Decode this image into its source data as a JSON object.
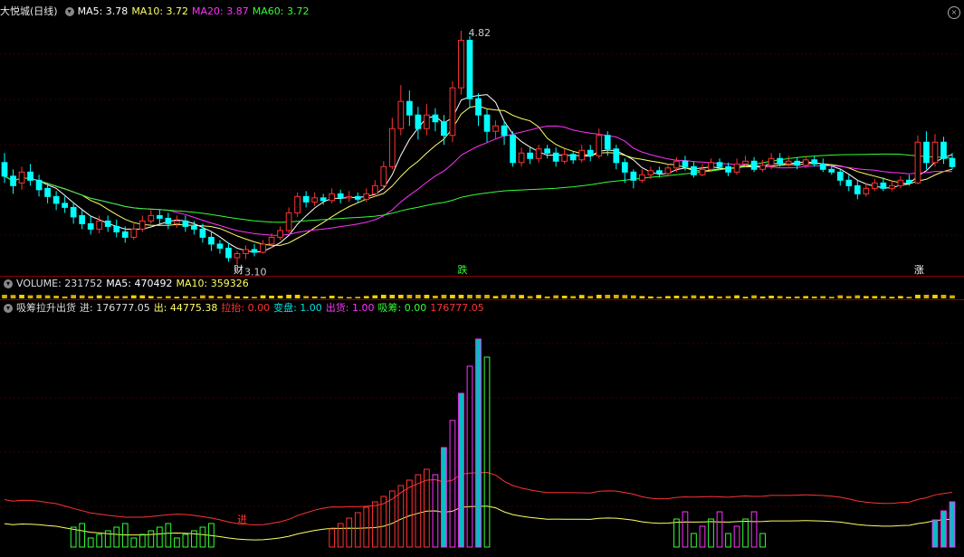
{
  "main": {
    "title": "大悦城(日线)",
    "ma5": "MA5: 3.78",
    "ma10": "MA10: 3.72",
    "ma20": "MA20: 3.87",
    "ma60": "MA60: 3.72",
    "high_label": "4.82",
    "low_label": "3.10",
    "marker_cai": "财",
    "marker_die": "跌",
    "marker_zhang": "涨"
  },
  "volume": {
    "label": "VOLUME: 231752",
    "ma5": "MA5: 470492",
    "ma10": "MA10: 359326"
  },
  "indicator": {
    "title": "吸筹拉升出货",
    "jin": "进: 176777.05",
    "chu": "出: 44775.38",
    "lata": "拉抬: 0.00",
    "biandian": "变盘: 1.00",
    "chuhuo": "出货: 1.00",
    "xichou": "吸筹: 0.00",
    "extra": "176777.05",
    "mark_jin": "进"
  },
  "colors": {
    "up": "#ff3333",
    "down": "#00ffff",
    "ma5": "#ffffff",
    "ma10": "#ffff66",
    "ma20": "#ff33ff",
    "ma60": "#33ff33"
  },
  "chart_data": {
    "type": "candlestick",
    "price_range": [
      3.05,
      4.9
    ],
    "high": 4.82,
    "low": 3.1,
    "candles": [
      [
        3.85,
        3.75,
        3.92,
        3.7
      ],
      [
        3.75,
        3.68,
        3.8,
        3.62
      ],
      [
        3.7,
        3.78,
        3.82,
        3.65
      ],
      [
        3.78,
        3.72,
        3.84,
        3.68
      ],
      [
        3.72,
        3.65,
        3.76,
        3.6
      ],
      [
        3.66,
        3.6,
        3.7,
        3.55
      ],
      [
        3.6,
        3.55,
        3.64,
        3.5
      ],
      [
        3.55,
        3.52,
        3.6,
        3.48
      ],
      [
        3.52,
        3.45,
        3.56,
        3.4
      ],
      [
        3.46,
        3.4,
        3.5,
        3.36
      ],
      [
        3.4,
        3.36,
        3.46,
        3.32
      ],
      [
        3.36,
        3.42,
        3.46,
        3.33
      ],
      [
        3.42,
        3.38,
        3.46,
        3.34
      ],
      [
        3.38,
        3.34,
        3.43,
        3.3
      ],
      [
        3.34,
        3.3,
        3.38,
        3.26
      ],
      [
        3.3,
        3.36,
        3.4,
        3.28
      ],
      [
        3.36,
        3.42,
        3.46,
        3.34
      ],
      [
        3.42,
        3.46,
        3.5,
        3.4
      ],
      [
        3.46,
        3.44,
        3.5,
        3.4
      ],
      [
        3.44,
        3.4,
        3.48,
        3.36
      ],
      [
        3.4,
        3.42,
        3.46,
        3.37
      ],
      [
        3.42,
        3.38,
        3.46,
        3.34
      ],
      [
        3.38,
        3.36,
        3.42,
        3.32
      ],
      [
        3.36,
        3.3,
        3.4,
        3.26
      ],
      [
        3.3,
        3.25,
        3.34,
        3.2
      ],
      [
        3.25,
        3.22,
        3.28,
        3.18
      ],
      [
        3.22,
        3.15,
        3.26,
        3.12
      ],
      [
        3.15,
        3.18,
        3.2,
        3.1
      ],
      [
        3.18,
        3.21,
        3.24,
        3.14
      ],
      [
        3.21,
        3.19,
        3.25,
        3.16
      ],
      [
        3.19,
        3.25,
        3.28,
        3.18
      ],
      [
        3.25,
        3.3,
        3.33,
        3.22
      ],
      [
        3.3,
        3.35,
        3.38,
        3.28
      ],
      [
        3.35,
        3.48,
        3.52,
        3.33
      ],
      [
        3.48,
        3.6,
        3.63,
        3.45
      ],
      [
        3.6,
        3.56,
        3.64,
        3.52
      ],
      [
        3.56,
        3.59,
        3.63,
        3.53
      ],
      [
        3.59,
        3.57,
        3.62,
        3.54
      ],
      [
        3.57,
        3.62,
        3.66,
        3.55
      ],
      [
        3.62,
        3.59,
        3.65,
        3.55
      ],
      [
        3.59,
        3.6,
        3.64,
        3.56
      ],
      [
        3.6,
        3.58,
        3.63,
        3.55
      ],
      [
        3.58,
        3.62,
        3.66,
        3.56
      ],
      [
        3.62,
        3.68,
        3.72,
        3.6
      ],
      [
        3.68,
        3.82,
        3.86,
        3.65
      ],
      [
        3.82,
        4.1,
        4.18,
        3.8
      ],
      [
        4.1,
        4.3,
        4.42,
        4.05
      ],
      [
        4.3,
        4.2,
        4.38,
        4.12
      ],
      [
        4.2,
        4.1,
        4.26,
        4.02
      ],
      [
        4.1,
        4.2,
        4.28,
        4.05
      ],
      [
        4.2,
        4.15,
        4.25,
        4.08
      ],
      [
        4.15,
        4.05,
        4.2,
        3.98
      ],
      [
        4.05,
        4.4,
        4.45,
        4.0
      ],
      [
        4.4,
        4.75,
        4.82,
        4.35
      ],
      [
        4.75,
        4.32,
        4.78,
        4.25
      ],
      [
        4.32,
        4.2,
        4.36,
        4.12
      ],
      [
        4.2,
        4.08,
        4.24,
        4.0
      ],
      [
        4.08,
        4.12,
        4.16,
        4.02
      ],
      [
        4.12,
        4.05,
        4.16,
        3.98
      ],
      [
        4.05,
        3.85,
        4.08,
        3.82
      ],
      [
        3.85,
        3.92,
        3.96,
        3.82
      ],
      [
        3.92,
        3.88,
        3.96,
        3.84
      ],
      [
        3.88,
        3.95,
        3.98,
        3.85
      ],
      [
        3.95,
        3.92,
        3.98,
        3.88
      ],
      [
        3.92,
        3.86,
        3.96,
        3.82
      ],
      [
        3.86,
        3.91,
        3.95,
        3.84
      ],
      [
        3.91,
        3.87,
        3.93,
        3.84
      ],
      [
        3.87,
        3.94,
        3.98,
        3.85
      ],
      [
        3.94,
        3.9,
        3.98,
        3.86
      ],
      [
        3.9,
        4.05,
        4.1,
        3.88
      ],
      [
        4.05,
        3.95,
        4.08,
        3.9
      ],
      [
        3.95,
        3.85,
        3.98,
        3.8
      ],
      [
        3.85,
        3.78,
        3.88,
        3.7
      ],
      [
        3.78,
        3.72,
        3.8,
        3.66
      ],
      [
        3.72,
        3.76,
        3.8,
        3.7
      ],
      [
        3.76,
        3.79,
        3.82,
        3.73
      ],
      [
        3.79,
        3.77,
        3.82,
        3.74
      ],
      [
        3.77,
        3.81,
        3.84,
        3.75
      ],
      [
        3.81,
        3.86,
        3.89,
        3.78
      ],
      [
        3.86,
        3.82,
        3.9,
        3.79
      ],
      [
        3.82,
        3.76,
        3.86,
        3.74
      ],
      [
        3.76,
        3.8,
        3.84,
        3.75
      ],
      [
        3.8,
        3.85,
        3.88,
        3.78
      ],
      [
        3.85,
        3.82,
        3.88,
        3.8
      ],
      [
        3.82,
        3.78,
        3.85,
        3.75
      ],
      [
        3.78,
        3.84,
        3.88,
        3.76
      ],
      [
        3.84,
        3.86,
        3.9,
        3.82
      ],
      [
        3.86,
        3.8,
        3.89,
        3.78
      ],
      [
        3.8,
        3.83,
        3.87,
        3.78
      ],
      [
        3.83,
        3.88,
        3.92,
        3.8
      ],
      [
        3.88,
        3.84,
        3.92,
        3.82
      ],
      [
        3.84,
        3.86,
        3.9,
        3.82
      ],
      [
        3.86,
        3.83,
        3.89,
        3.8
      ],
      [
        3.83,
        3.87,
        3.9,
        3.81
      ],
      [
        3.87,
        3.84,
        3.9,
        3.82
      ],
      [
        3.84,
        3.8,
        3.88,
        3.78
      ],
      [
        3.8,
        3.78,
        3.84,
        3.76
      ],
      [
        3.78,
        3.72,
        3.8,
        3.68
      ],
      [
        3.72,
        3.68,
        3.76,
        3.64
      ],
      [
        3.68,
        3.62,
        3.72,
        3.58
      ],
      [
        3.62,
        3.66,
        3.7,
        3.6
      ],
      [
        3.66,
        3.7,
        3.73,
        3.64
      ],
      [
        3.7,
        3.66,
        3.74,
        3.64
      ],
      [
        3.66,
        3.68,
        3.72,
        3.64
      ],
      [
        3.68,
        3.72,
        3.75,
        3.66
      ],
      [
        3.72,
        3.7,
        3.76,
        3.68
      ],
      [
        3.7,
        4.0,
        4.05,
        3.69
      ],
      [
        4.0,
        3.85,
        4.08,
        3.8
      ],
      [
        3.85,
        4.0,
        4.06,
        3.82
      ],
      [
        4.0,
        3.88,
        4.04,
        3.84
      ],
      [
        3.88,
        3.82,
        3.92,
        3.8
      ]
    ],
    "volume_series": [],
    "indicator_series": {
      "red_boxes_profile": [
        0.05,
        0.06,
        0.08,
        0.1,
        0.14,
        0.2,
        0.28,
        0.38,
        0.52,
        0.7,
        0.9,
        1.0
      ],
      "right_cluster_profile": [
        0.25,
        0.35,
        0.5,
        0.6
      ]
    }
  }
}
